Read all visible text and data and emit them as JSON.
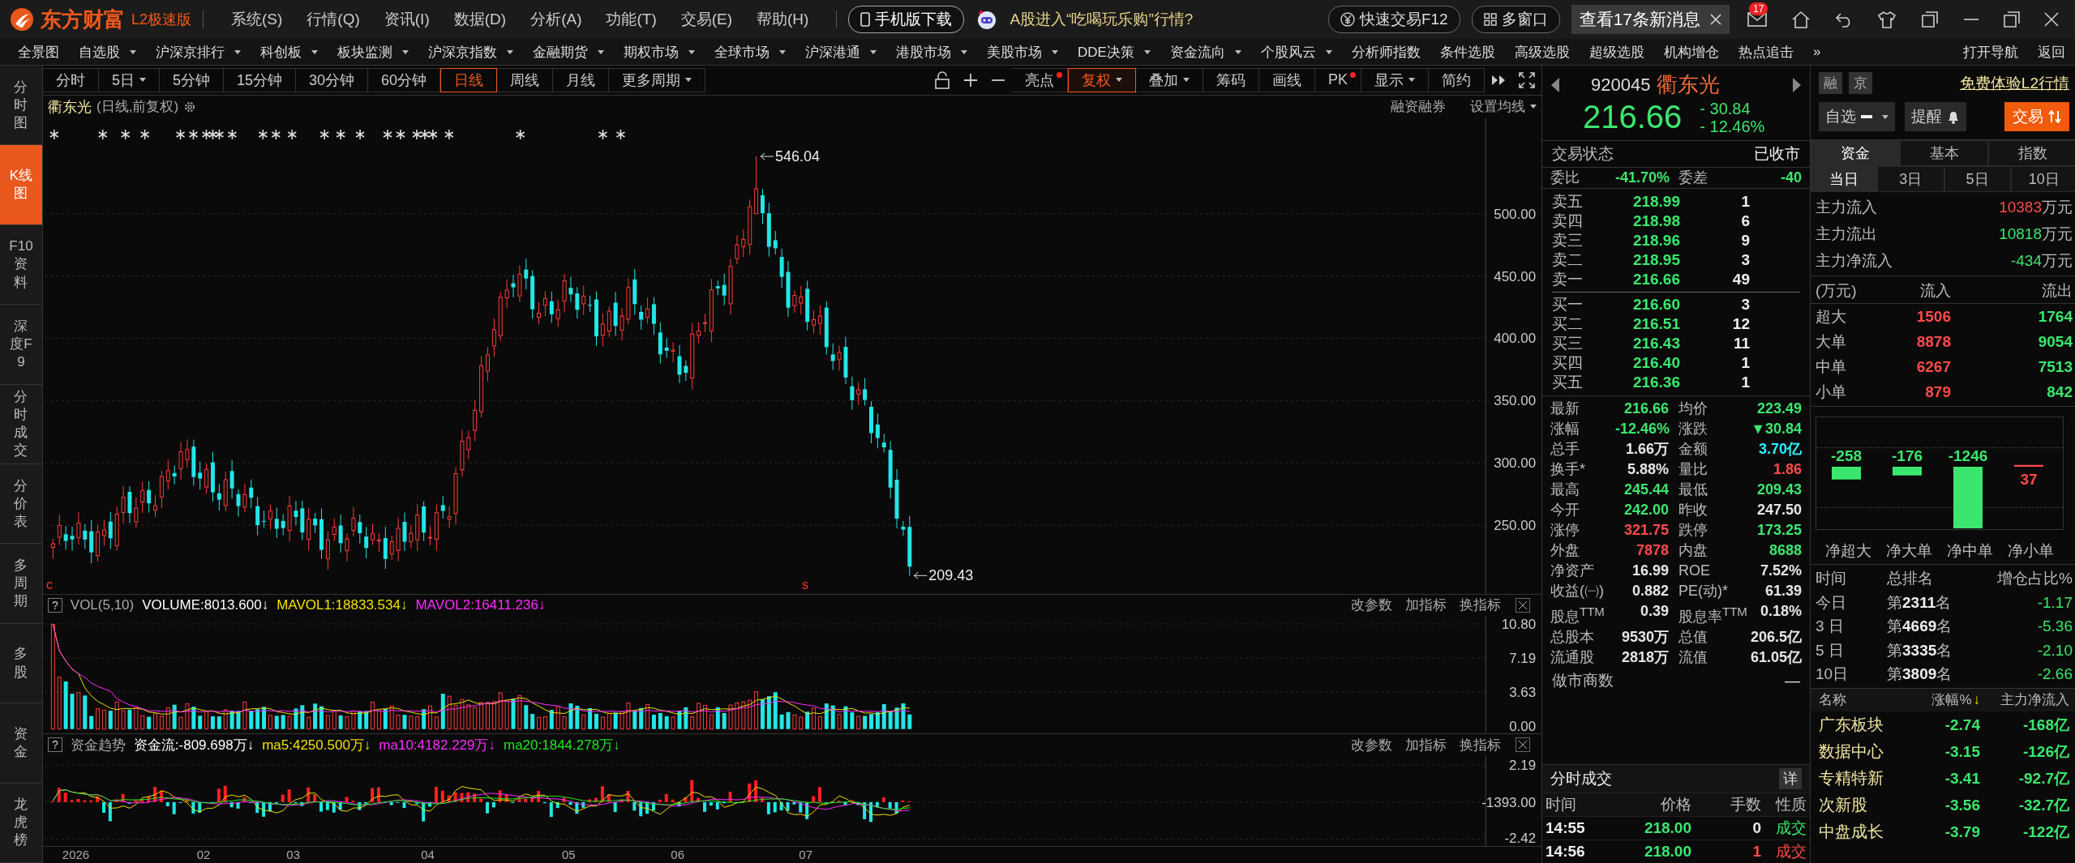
{
  "topbar": {
    "logo": "东方财富",
    "edition": "L2极速版",
    "menu": [
      "系统(S)",
      "行情(Q)",
      "资讯(I)",
      "数据(D)",
      "分析(A)",
      "功能(T)",
      "交易(E)",
      "帮助(H)"
    ],
    "phone_button": "手机版下载",
    "promo": "A股进入“吃喝玩乐购”行情?",
    "quick_trade": "快速交易F12",
    "multi_window": "多窗口",
    "messages": "查看17条新消息",
    "mail_badge": "17"
  },
  "navbar": {
    "items": [
      {
        "label": "全景图",
        "menu": false
      },
      {
        "label": "自选股",
        "menu": true
      },
      {
        "label": "沪深京排行",
        "menu": true
      },
      {
        "label": "科创板",
        "menu": true
      },
      {
        "label": "板块监测",
        "menu": true
      },
      {
        "label": "沪深京指数",
        "menu": true
      },
      {
        "label": "金融期货",
        "menu": true
      },
      {
        "label": "期权市场",
        "menu": true
      },
      {
        "label": "全球市场",
        "menu": true
      },
      {
        "label": "沪深港通",
        "menu": true
      },
      {
        "label": "港股市场",
        "menu": true
      },
      {
        "label": "美股市场",
        "menu": true
      },
      {
        "label": "DDE决策",
        "menu": true
      },
      {
        "label": "资金流向",
        "menu": true
      },
      {
        "label": "个股风云",
        "menu": true
      },
      {
        "label": "分析师指数",
        "menu": false
      },
      {
        "label": "条件选股",
        "menu": false
      },
      {
        "label": "高级选股",
        "menu": false
      },
      {
        "label": "超级选股",
        "menu": false
      },
      {
        "label": "机构增仓",
        "menu": false
      },
      {
        "label": "热点追击",
        "menu": false
      }
    ],
    "more": "»",
    "right": [
      "打开导航",
      "返回"
    ]
  },
  "sidebar": [
    {
      "label": "分时图",
      "selected": false
    },
    {
      "label": "K线图",
      "selected": true
    },
    {
      "label": "F10资料",
      "selected": false
    },
    {
      "label": "深度F9",
      "selected": false
    },
    {
      "label": "分时成交",
      "selected": false
    },
    {
      "label": "分价表",
      "selected": false
    },
    {
      "label": "多周期",
      "selected": false
    },
    {
      "label": "多股",
      "selected": false
    },
    {
      "label": "资金",
      "selected": false
    },
    {
      "label": "龙虎榜",
      "selected": false
    }
  ],
  "toolbar": {
    "periods": [
      {
        "label": "分时",
        "selected": false,
        "menu": false
      },
      {
        "label": "5日",
        "selected": false,
        "menu": true
      },
      {
        "label": "5分钟",
        "selected": false,
        "menu": false
      },
      {
        "label": "15分钟",
        "selected": false,
        "menu": false
      },
      {
        "label": "30分钟",
        "selected": false,
        "menu": false
      },
      {
        "label": "60分钟",
        "selected": false,
        "menu": false
      },
      {
        "label": "日线",
        "selected": true,
        "menu": false
      },
      {
        "label": "周线",
        "selected": false,
        "menu": false
      },
      {
        "label": "月线",
        "selected": false,
        "menu": false
      },
      {
        "label": "更多周期",
        "selected": false,
        "menu": true
      }
    ],
    "tools": [
      {
        "label": "亮点",
        "dot": true,
        "menu": false,
        "selected": false
      },
      {
        "label": "复权",
        "dot": false,
        "menu": true,
        "selected": true
      },
      {
        "label": "叠加",
        "dot": false,
        "menu": true,
        "selected": false
      },
      {
        "label": "筹码",
        "dot": false,
        "menu": false,
        "selected": false
      },
      {
        "label": "画线",
        "dot": false,
        "menu": false,
        "selected": false
      },
      {
        "label": "PK",
        "dot": true,
        "menu": false,
        "selected": false
      },
      {
        "label": "显示",
        "dot": false,
        "menu": true,
        "selected": false
      },
      {
        "label": "简约",
        "dot": false,
        "menu": false,
        "selected": false
      }
    ]
  },
  "chart": {
    "title": "衢东光",
    "subtitle": "(日线,前复权)",
    "links": [
      "融资融券",
      "设置均线"
    ],
    "high_label": "546.04",
    "low_label": "209.43",
    "price_ticks": [
      "500.00",
      "450.00",
      "400.00",
      "350.00",
      "300.00",
      "250.00"
    ],
    "markers": [
      "c",
      "s"
    ],
    "dates": [
      "2026",
      "02",
      "03",
      "04",
      "05",
      "06",
      "07"
    ]
  },
  "volume": {
    "help": "?",
    "label": "VOL(5,10)",
    "series": [
      {
        "text": "VOLUME:8013.600↓",
        "color": "#ffffff"
      },
      {
        "text": "MAVOL1:18833.534↓",
        "color": "#f0e000"
      },
      {
        "text": "MAVOL2:16411.236↓",
        "color": "#ff2bff"
      }
    ],
    "actions": [
      "改参数",
      "加指标",
      "换指标"
    ],
    "ticks": [
      "10.80",
      "7.19",
      "3.63",
      "0.00"
    ]
  },
  "fund": {
    "help": "?",
    "label": "资金趋势",
    "series": [
      {
        "text": "资金流:-809.698万↓",
        "color": "#ffffff"
      },
      {
        "text": "ma5:4250.500万↓",
        "color": "#f0e000"
      },
      {
        "text": "ma10:4182.229万↓",
        "color": "#ff2bff"
      },
      {
        "text": "ma20:1844.278万↓",
        "color": "#22e622"
      }
    ],
    "actions": [
      "改参数",
      "加指标",
      "换指标"
    ],
    "ticks": [
      "2.19",
      "-1393.00",
      "-2.42"
    ]
  },
  "quote": {
    "code": "920045",
    "name": "衢东光",
    "price": "216.66",
    "change": "- 30.84",
    "change_pct": "- 12.46%",
    "color": "#3ce66e",
    "status_label": "交易状态",
    "status": "已收市",
    "ratio": [
      {
        "label": "委比",
        "value": "-41.70%",
        "color": "#3ce66e"
      },
      {
        "label": "委差",
        "value": "-40",
        "color": "#3ce66e"
      }
    ],
    "asks": [
      {
        "label": "卖五",
        "price": "218.99",
        "volume": "1",
        "color": "#3ce66e"
      },
      {
        "label": "卖四",
        "price": "218.98",
        "volume": "6",
        "color": "#3ce66e"
      },
      {
        "label": "卖三",
        "price": "218.96",
        "volume": "9",
        "color": "#3ce66e"
      },
      {
        "label": "卖二",
        "price": "218.95",
        "volume": "3",
        "color": "#3ce66e"
      },
      {
        "label": "卖一",
        "price": "216.66",
        "volume": "49",
        "color": "#3ce66e"
      }
    ],
    "bids": [
      {
        "label": "买一",
        "price": "216.60",
        "volume": "3",
        "color": "#3ce66e"
      },
      {
        "label": "买二",
        "price": "216.51",
        "volume": "12",
        "color": "#3ce66e"
      },
      {
        "label": "买三",
        "price": "216.43",
        "volume": "11",
        "color": "#3ce66e"
      },
      {
        "label": "买四",
        "price": "216.40",
        "volume": "1",
        "color": "#3ce66e"
      },
      {
        "label": "买五",
        "price": "216.36",
        "volume": "1",
        "color": "#3ce66e"
      }
    ],
    "stats": [
      [
        {
          "label": "最新",
          "value": "216.66",
          "color": "#3ce66e"
        },
        {
          "label": "均价",
          "value": "223.49",
          "color": "#3ce66e"
        }
      ],
      [
        {
          "label": "涨幅",
          "value": "-12.46%",
          "color": "#3ce66e"
        },
        {
          "label": "涨跌",
          "value": "▼30.84",
          "color": "#3ce66e"
        }
      ],
      [
        {
          "label": "总手",
          "value": "1.66万",
          "color": "#e6e6e6"
        },
        {
          "label": "金额",
          "value": "3.70亿",
          "color": "#2ef2ff"
        }
      ],
      [
        {
          "label": "换手*",
          "value": "5.88%",
          "color": "#e6e6e6"
        },
        {
          "label": "量比",
          "value": "1.86",
          "color": "#ff4a4a"
        }
      ],
      [
        {
          "label": "最高",
          "value": "245.44",
          "color": "#3ce66e"
        },
        {
          "label": "最低",
          "value": "209.43",
          "color": "#3ce66e"
        }
      ],
      [
        {
          "label": "今开",
          "value": "242.00",
          "color": "#3ce66e"
        },
        {
          "label": "昨收",
          "value": "247.50",
          "color": "#e6e6e6"
        }
      ],
      [
        {
          "label": "涨停",
          "value": "321.75",
          "color": "#ff4a4a"
        },
        {
          "label": "跌停",
          "value": "173.25",
          "color": "#3ce66e"
        }
      ],
      [
        {
          "label": "外盘",
          "value": "7878",
          "color": "#ff4a4a"
        },
        {
          "label": "内盘",
          "value": "8688",
          "color": "#3ce66e"
        }
      ],
      [
        {
          "label": "净资产",
          "value": "16.99",
          "color": "#e6e6e6"
        },
        {
          "label": "ROE",
          "value": "7.52%",
          "color": "#e6e6e6"
        }
      ],
      [
        {
          "label": "收益(㈠)",
          "value": "0.882",
          "color": "#e6e6e6"
        },
        {
          "label": "PE(动)*",
          "value": "61.39",
          "color": "#e6e6e6"
        }
      ],
      [
        {
          "label": "股息$^{TTM}$",
          "value": "0.39",
          "color": "#e6e6e6"
        },
        {
          "label": "股息率$^{TTM}$",
          "value": "0.18%",
          "color": "#e6e6e6"
        }
      ],
      [
        {
          "label": "总股本",
          "value": "9530万",
          "color": "#e6e6e6"
        },
        {
          "label": "总值",
          "value": "206.5亿",
          "color": "#e6e6e6"
        }
      ],
      [
        {
          "label": "流通股",
          "value": "2818万",
          "color": "#e6e6e6"
        },
        {
          "label": "流值",
          "value": "61.05亿",
          "color": "#e6e6e6"
        }
      ]
    ],
    "market_maker": {
      "label": "做市商数",
      "value": "—"
    }
  },
  "trades": {
    "title": "分时成交",
    "detail": "详",
    "columns": [
      "时间",
      "价格",
      "手数",
      "性质"
    ],
    "rows": [
      {
        "cells": [
          {
            "text": "14:55",
            "color": "#eeeeee"
          },
          {
            "text": "218.00",
            "color": "#3ce66e"
          },
          {
            "text": "0",
            "color": "#e6e6e6"
          },
          {
            "text": "成交",
            "color": "#3ce66e"
          }
        ]
      },
      {
        "cells": [
          {
            "text": "14:56",
            "color": "#eeeeee"
          },
          {
            "text": "218.00",
            "color": "#3ce66e"
          },
          {
            "text": "1",
            "color": "#ff4a4a"
          },
          {
            "text": "成交",
            "color": "#ff4a4a"
          }
        ]
      }
    ]
  },
  "fundpanel": {
    "badges": [
      "融",
      "京"
    ],
    "l2_link": "免费体验L2行情",
    "watch": "自选",
    "alert": "提醒",
    "trade": "交易",
    "tabs": [
      {
        "label": "资金",
        "selected": true
      },
      {
        "label": "基本",
        "selected": false
      },
      {
        "label": "指数",
        "selected": false
      }
    ],
    "subtabs": [
      {
        "label": "当日",
        "selected": true
      },
      {
        "label": "3日",
        "selected": false
      },
      {
        "label": "5日",
        "selected": false
      },
      {
        "label": "10日",
        "selected": false
      }
    ],
    "flows": [
      {
        "label": "主力流入",
        "value": "10383",
        "unit": "万元",
        "color": "#ff4a4a"
      },
      {
        "label": "主力流出",
        "value": "10818",
        "unit": "万元",
        "color": "#3ce66e"
      },
      {
        "label": "主力净流入",
        "value": "-434",
        "unit": "万元",
        "color": "#3ce66e"
      }
    ],
    "orders": {
      "columns": [
        "(万元)",
        "流入",
        "流出"
      ],
      "rows": [
        {
          "label": "超大",
          "inflow": "1506",
          "outflow": "1764"
        },
        {
          "label": "大单",
          "inflow": "8878",
          "outflow": "9054"
        },
        {
          "label": "中单",
          "inflow": "6267",
          "outflow": "7513"
        },
        {
          "label": "小单",
          "inflow": "879",
          "outflow": "842"
        }
      ]
    },
    "net": {
      "chart_data": {
        "type": "bar",
        "categories": [
          "净超大",
          "净大单",
          "净中单",
          "净小单"
        ],
        "values": [
          -258,
          -176,
          -1246,
          37
        ],
        "data_labels": true
      }
    },
    "ranking": {
      "columns": [
        "时间",
        "总排名",
        "增仓占比%"
      ],
      "rows": [
        {
          "period": "今日",
          "rank": "第**2311**名",
          "ratio": "-1.17"
        },
        {
          "period": "3 日",
          "rank": "第**4669**名",
          "ratio": "-5.36"
        },
        {
          "period": "5 日",
          "rank": "第**3335**名",
          "ratio": "-2.10"
        },
        {
          "period": "10日",
          "rank": "第**3809**名",
          "ratio": "-2.66"
        }
      ]
    },
    "sectors": {
      "columns": [
        {
          "label": "名称"
        },
        {
          "label": "涨幅%",
          "sort": "↓"
        },
        {
          "label": "主力净流入"
        }
      ],
      "rows": [
        {
          "name": "广东板块",
          "change": "-2.74",
          "flow": "-168亿"
        },
        {
          "name": "数据中心",
          "change": "-3.15",
          "flow": "-126亿"
        },
        {
          "name": "专精特新",
          "change": "-3.41",
          "flow": "-92.7亿"
        },
        {
          "name": "次新股",
          "change": "-3.56",
          "flow": "-32.7亿"
        },
        {
          "name": "中盘成长",
          "change": "-3.79",
          "flow": "-122亿"
        }
      ]
    }
  }
}
